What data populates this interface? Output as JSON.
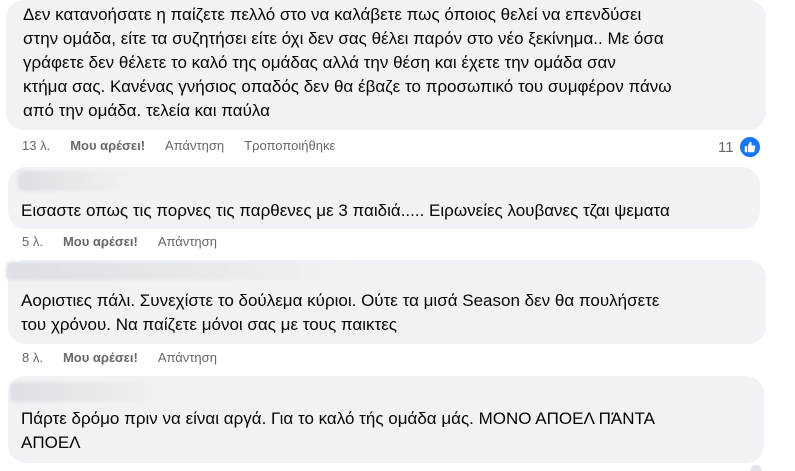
{
  "comments": [
    {
      "text": "Δεν κατανοήσατε η παίζετε πελλό στο να καλάβετε πως όποιος θελεί να επενδύσει\nστην ομάδα, είτε τα συζητήσει είτε όχι δεν σας θέλει παρόν στο νέο ξεκίνημα.. Με όσα\nγράφετε δεν θέλετε το καλό της ομάδας αλλά την θέση και έχετε την ομάδα σαν\nκτήμα σας. Κανένας γνήσιος οπαδός δεν θα έβαζε το προσωπικό του συμφέρον πάνω\nαπό την ομάδα. τελεία και παύλα",
      "time": "13 λ.",
      "like_label": "Μου αρέσει!",
      "reply_label": "Απάντηση",
      "edited_label": "Τροποποιήθηκε",
      "reaction_count": "11"
    },
    {
      "text": "Εισαστε οπως τις πορνες τις παρθενες με 3 παιδιά..... Ειρωνείες λουβανες τζαι ψεματα",
      "time": "5 λ.",
      "like_label": "Μου αρέσει!",
      "reply_label": "Απάντηση"
    },
    {
      "text": "Αοριστιες πάλι. Συνεχίστε το δούλεμα κύριοι. Ούτε τα μισά Season δεν θα πουλήσετε\nτου χρόνου. Να παίζετε μόνοι σας με τους παικτες",
      "time": "8 λ.",
      "like_label": "Μου αρέσει!",
      "reply_label": "Απάντηση"
    },
    {
      "text": "Πάρτε δρόμο πριν να είναι αργά. Για το καλό τής ομάδα μάς. ΜΟΝΟ ΑΠΟΕΛ ΠΆΝΤΑ\nΑΠΟΕΛ"
    }
  ],
  "icons": {
    "like_badge": "thumbs-up-icon"
  },
  "colors": {
    "bubble": "#f0f2f5",
    "meta_text": "#65676b",
    "like_blue": "#1877f2"
  }
}
